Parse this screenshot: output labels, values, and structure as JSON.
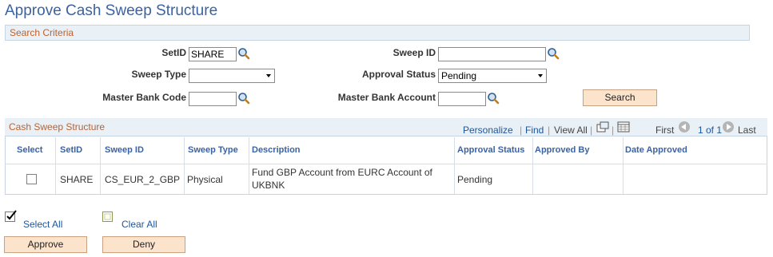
{
  "page": {
    "title": "Approve Cash Sweep Structure"
  },
  "search": {
    "section_title": "Search Criteria",
    "setid_label": "SetID",
    "setid_value": "SHARE",
    "sweep_id_label": "Sweep ID",
    "sweep_id_value": "",
    "sweep_type_label": "Sweep Type",
    "sweep_type_value": "",
    "approval_status_label": "Approval Status",
    "approval_status_value": "Pending",
    "master_bank_code_label": "Master Bank Code",
    "master_bank_code_value": "",
    "master_bank_account_label": "Master Bank Account",
    "master_bank_account_value": "",
    "search_button": "Search"
  },
  "grid": {
    "title": "Cash Sweep Structure",
    "personalize": "Personalize",
    "find": "Find",
    "view_all": "View All",
    "first": "First",
    "range": "1 of 1",
    "last": "Last",
    "columns": [
      "Select",
      "SetID",
      "Sweep ID",
      "Sweep Type",
      "Description",
      "Approval Status",
      "Approved By",
      "Date Approved"
    ],
    "rows": [
      {
        "selected": false,
        "setid": "SHARE",
        "sweep_id": "CS_EUR_2_GBP",
        "sweep_type": "Physical",
        "description_line1": "Fund GBP Account from EURC Account of",
        "description_line2": "UKBNK",
        "approval_status": "Pending",
        "approved_by": "",
        "date_approved": ""
      }
    ]
  },
  "footer": {
    "select_all": "Select All",
    "clear_all": "Clear All",
    "approve_button": "Approve",
    "deny_button": "Deny"
  },
  "colors": {
    "title": "#3b62a3",
    "section_title": "#c0612b",
    "link": "#1c56a0",
    "button_bg": "#fbe3cc",
    "header_bg": "#e9f0f6"
  }
}
